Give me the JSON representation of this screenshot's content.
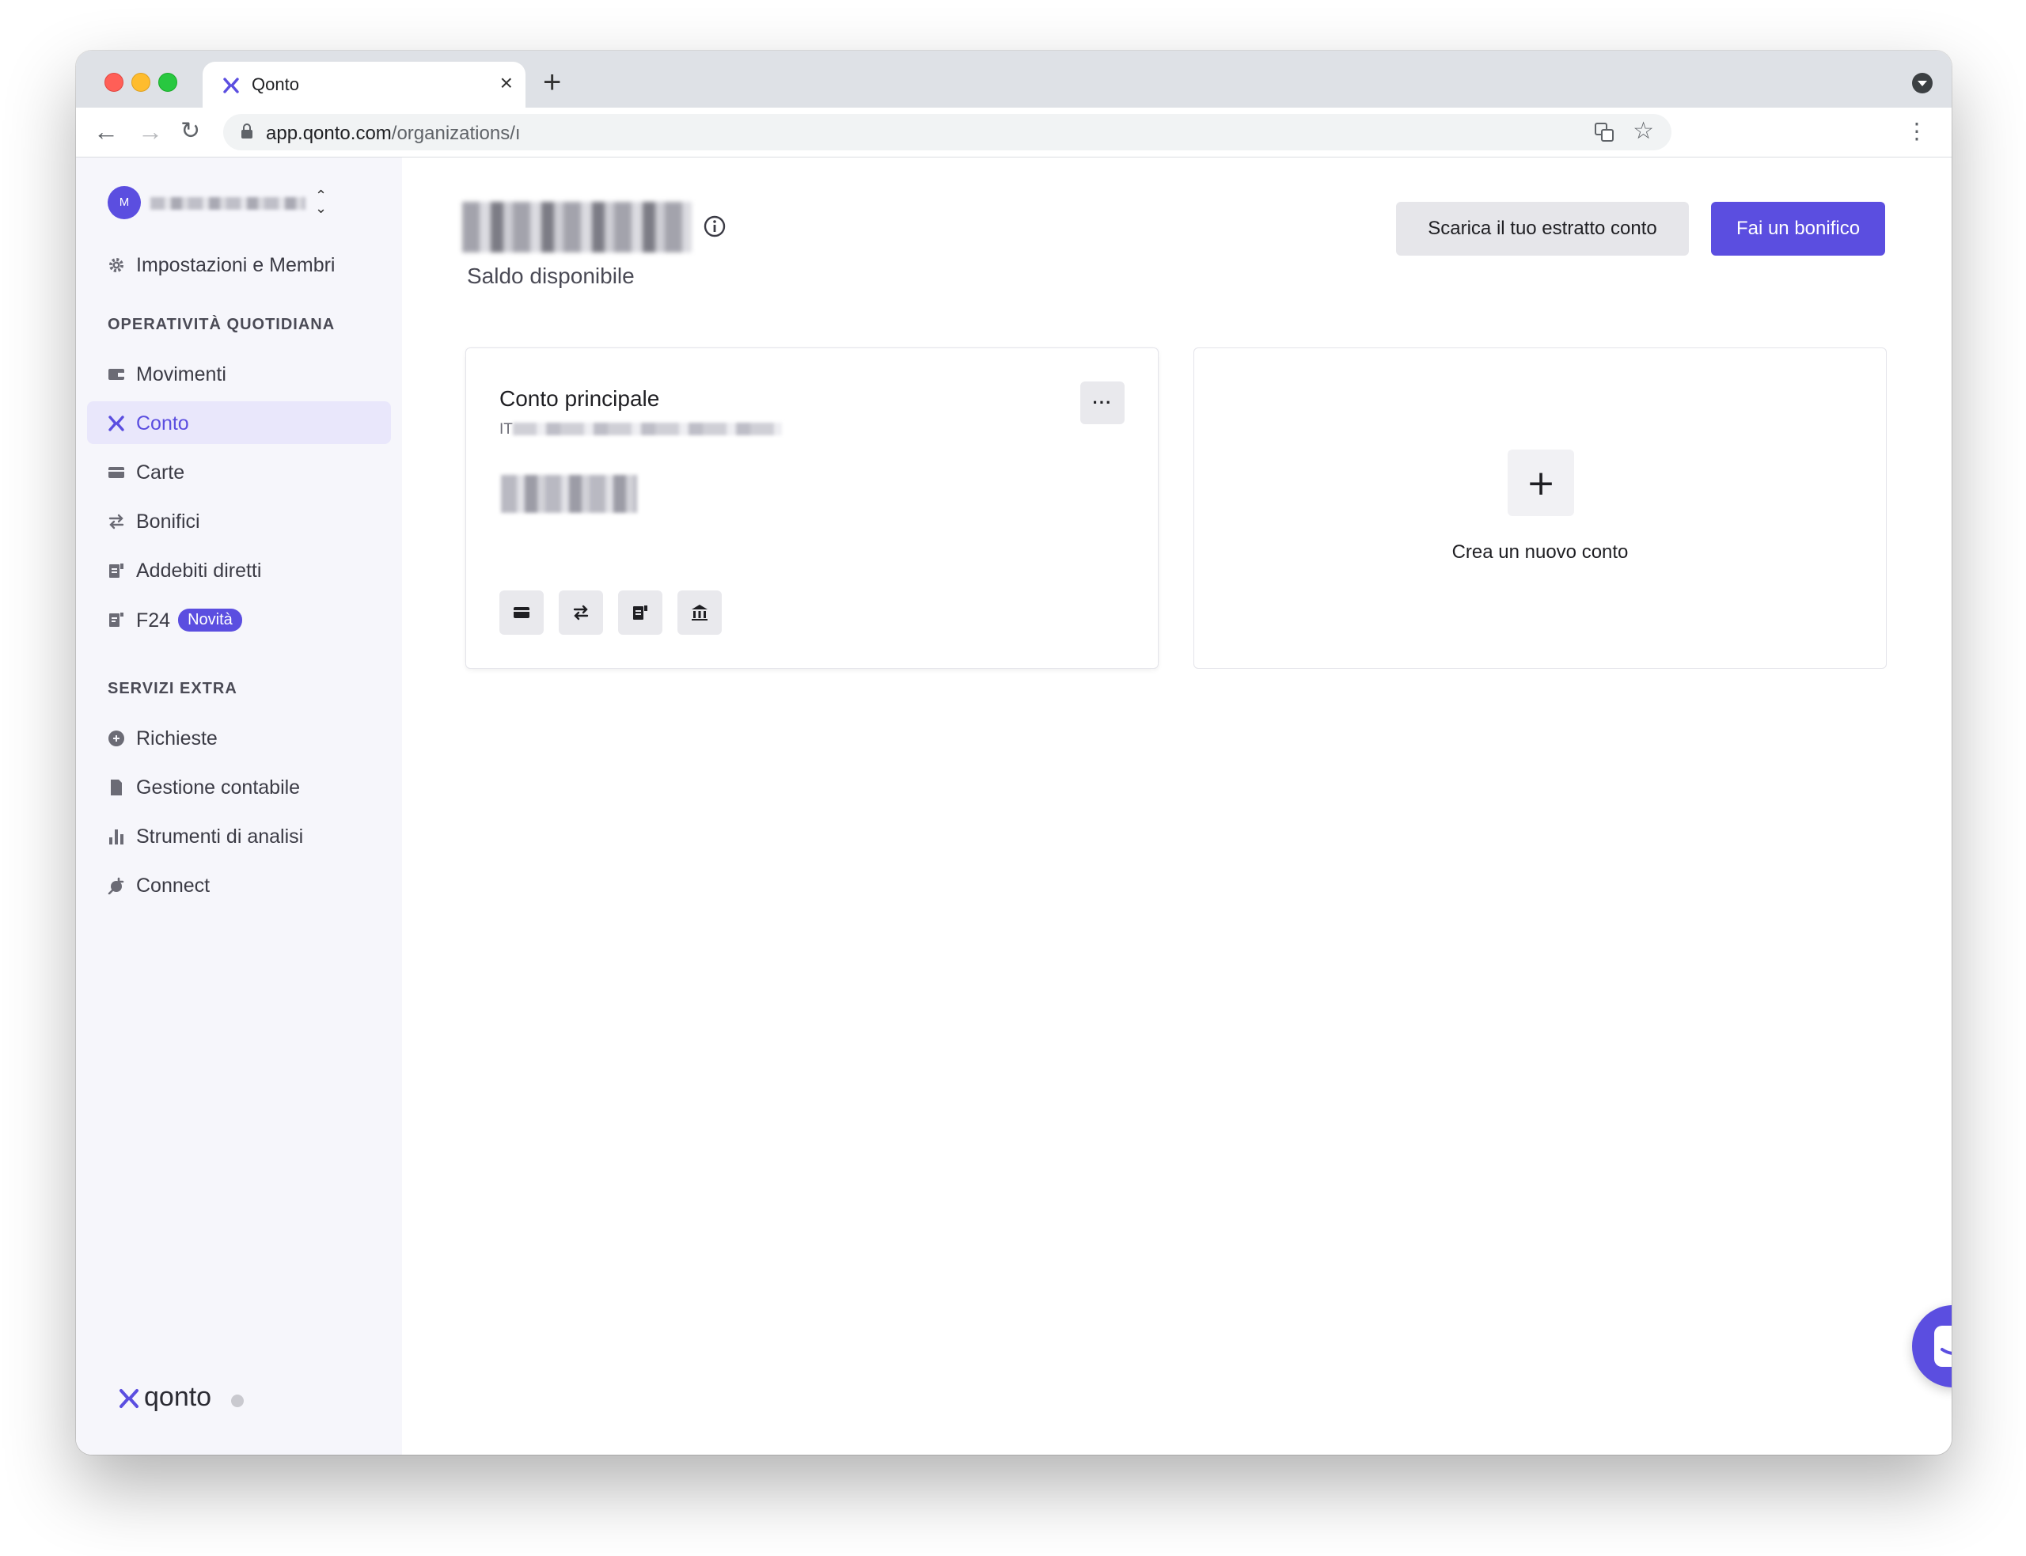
{
  "browser": {
    "tab_title": "Qonto",
    "url_host": "app.qonto.com",
    "url_path": "/organizations/ı"
  },
  "sidebar": {
    "org_initial": "M",
    "settings_label": "Impostazioni e Membri",
    "section_daily": "OPERATIVITÀ QUOTIDIANA",
    "daily_items": [
      {
        "label": "Movimenti",
        "icon": "wallet-icon"
      },
      {
        "label": "Conto",
        "icon": "qonto-logo-icon",
        "active": true
      },
      {
        "label": "Carte",
        "icon": "card-icon"
      },
      {
        "label": "Bonifici",
        "icon": "transfer-arrows-icon"
      },
      {
        "label": "Addebiti diretti",
        "icon": "direct-debit-icon"
      },
      {
        "label": "F24",
        "icon": "f24-document-icon",
        "badge": "Novità"
      }
    ],
    "section_extra": "SERVIZI EXTRA",
    "extra_items": [
      {
        "label": "Richieste",
        "icon": "chat-bubble-icon"
      },
      {
        "label": "Gestione contabile",
        "icon": "document-icon"
      },
      {
        "label": "Strumenti di analisi",
        "icon": "bar-chart-icon"
      },
      {
        "label": "Connect",
        "icon": "plug-icon"
      }
    ],
    "brand_name": "qonto"
  },
  "main": {
    "balance_label": "Saldo disponibile",
    "download_statement_label": "Scarica il tuo estratto conto",
    "make_transfer_label": "Fai un bonifico",
    "account_card": {
      "title": "Conto principale",
      "iban_prefix": "IT",
      "menu_label": "···"
    },
    "new_account_card": {
      "plus": "+",
      "label": "Crea un nuovo conto"
    }
  }
}
